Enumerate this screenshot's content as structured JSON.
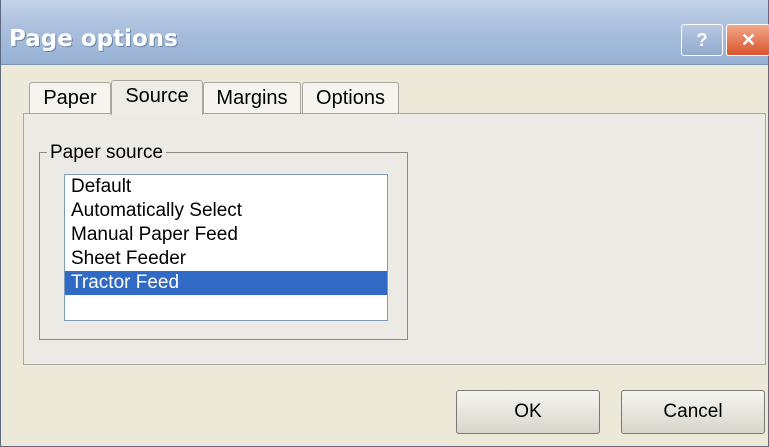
{
  "window": {
    "title": "Page options",
    "help_label": "?",
    "close_label": "✕"
  },
  "tabs": [
    {
      "label": "Paper"
    },
    {
      "label": "Source"
    },
    {
      "label": "Margins"
    },
    {
      "label": "Options"
    }
  ],
  "active_tab": "Source",
  "paper_source": {
    "group_label": "Paper source",
    "items": [
      {
        "label": "Default"
      },
      {
        "label": "Automatically Select"
      },
      {
        "label": "Manual Paper Feed"
      },
      {
        "label": "Sheet Feeder"
      },
      {
        "label": "Tractor Feed"
      }
    ],
    "selected": "Tractor Feed"
  },
  "buttons": {
    "ok_label": "OK",
    "cancel_label": "Cancel"
  },
  "colors": {
    "selection": "#316ac5",
    "close": "#d9542c"
  }
}
